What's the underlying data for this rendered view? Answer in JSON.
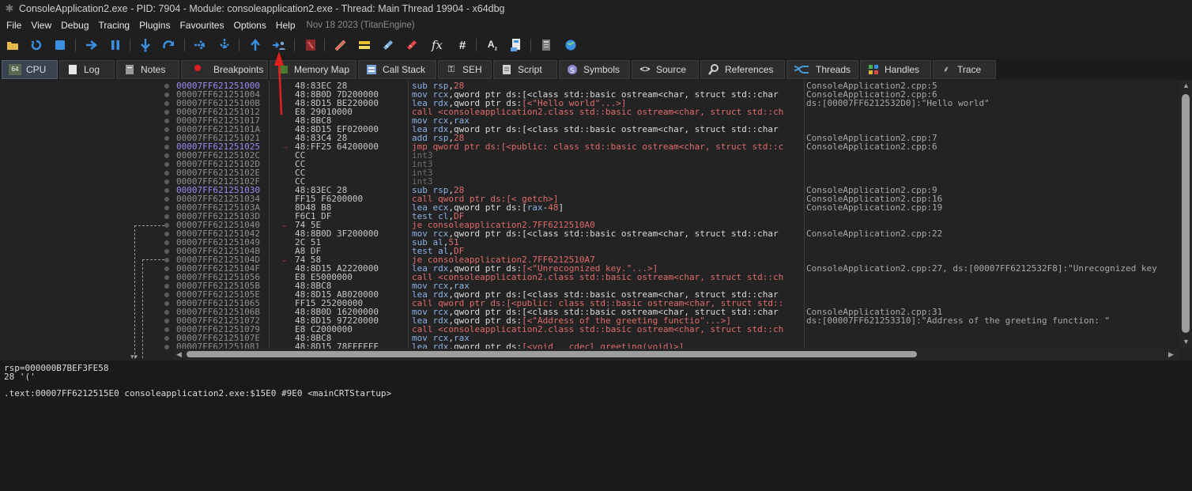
{
  "window": {
    "title": "ConsoleApplication2.exe - PID: 7904 - Module: consoleapplication2.exe - Thread: Main Thread 19904 - x64dbg"
  },
  "menu": [
    "File",
    "View",
    "Debug",
    "Tracing",
    "Plugins",
    "Favourites",
    "Options",
    "Help"
  ],
  "build": "Nov 18 2023 (TitanEngine)",
  "toolbar_icons": [
    "open-icon",
    "restart-icon",
    "stop-icon",
    "run-icon",
    "pause-icon",
    "step-into-icon",
    "step-over-icon",
    "trace-into-icon",
    "trace-over-icon",
    "execute-till-return-icon",
    "run-to-user-code-icon",
    "scylla-icon",
    "patch-icon",
    "comment-icon",
    "label-icon",
    "bookmark-icon",
    "function-icon",
    "hash-icon",
    "font-icon",
    "calc-icon",
    "notes-icon",
    "globe-icon"
  ],
  "tabs": [
    {
      "label": "CPU",
      "icon": "cpu-icon",
      "active": true
    },
    {
      "label": "Log",
      "icon": "log-icon"
    },
    {
      "label": "Notes",
      "icon": "notes-icon"
    },
    {
      "label": "Breakpoints",
      "icon": "breakpoint-icon"
    },
    {
      "label": "Memory Map",
      "icon": "memory-icon"
    },
    {
      "label": "Call Stack",
      "icon": "callstack-icon"
    },
    {
      "label": "SEH",
      "icon": "seh-icon"
    },
    {
      "label": "Script",
      "icon": "script-icon"
    },
    {
      "label": "Symbols",
      "icon": "symbols-icon"
    },
    {
      "label": "Source",
      "icon": "source-icon"
    },
    {
      "label": "References",
      "icon": "references-icon"
    },
    {
      "label": "Threads",
      "icon": "threads-icon"
    },
    {
      "label": "Handles",
      "icon": "handles-icon"
    },
    {
      "label": "Trace",
      "icon": "trace-icon"
    }
  ],
  "disasm": [
    {
      "addr": "00007FF621251000",
      "bytes": "48:83EC 28",
      "ins": "sub rsp,28",
      "comment": "ConsoleApplication2.cpp:5",
      "hl": true
    },
    {
      "addr": "00007FF621251004",
      "bytes": "48:8B0D 7D200000",
      "ins": "mov rcx,qword ptr ds:[<class std::basic_ostream<char, struct std::char_",
      "comment": "ConsoleApplication2.cpp:6"
    },
    {
      "addr": "00007FF62125100B",
      "bytes": "48:8D15 BE220000",
      "ins": "lea rdx,qword ptr ds:[<\"Hello world\"...>]",
      "comment": "ds:[00007FF6212532D0]:\"Hello world\""
    },
    {
      "addr": "00007FF621251012",
      "bytes": "E8 29010000",
      "ins": "call <consoleapplication2.class std::basic_ostream<char, struct std::ch",
      "comment": ""
    },
    {
      "addr": "00007FF621251017",
      "bytes": "48:8BC8",
      "ins": "mov rcx,rax",
      "comment": ""
    },
    {
      "addr": "00007FF62125101A",
      "bytes": "48:8D15 EF020000",
      "ins": "lea rdx,qword ptr ds:[<class std::basic_ostream<char, struct std::char_",
      "comment": ""
    },
    {
      "addr": "00007FF621251021",
      "bytes": "48:83C4 28",
      "ins": "add rsp,28",
      "comment": "ConsoleApplication2.cpp:7"
    },
    {
      "addr": "00007FF621251025",
      "bytes": "48:FF25 64200000",
      "ins": "jmp qword ptr ds:[<public: class std::basic_ostream<char, struct std::c",
      "comment": "ConsoleApplication2.cpp:6",
      "hl": true
    },
    {
      "addr": "00007FF62125102C",
      "bytes": "CC",
      "ins": "int3",
      "comment": ""
    },
    {
      "addr": "00007FF62125102D",
      "bytes": "CC",
      "ins": "int3",
      "comment": ""
    },
    {
      "addr": "00007FF62125102E",
      "bytes": "CC",
      "ins": "int3",
      "comment": ""
    },
    {
      "addr": "00007FF62125102F",
      "bytes": "CC",
      "ins": "int3",
      "comment": ""
    },
    {
      "addr": "00007FF621251030",
      "bytes": "48:83EC 28",
      "ins": "sub rsp,28",
      "comment": "ConsoleApplication2.cpp:9",
      "hl": true
    },
    {
      "addr": "00007FF621251034",
      "bytes": "FF15 F6200000",
      "ins": "call qword ptr ds:[<_getch>]",
      "comment": "ConsoleApplication2.cpp:16"
    },
    {
      "addr": "00007FF62125103A",
      "bytes": "8D48 B8",
      "ins": "lea ecx,qword ptr ds:[rax-48]",
      "comment": "ConsoleApplication2.cpp:19"
    },
    {
      "addr": "00007FF62125103D",
      "bytes": "F6C1 DF",
      "ins": "test cl,DF",
      "comment": ""
    },
    {
      "addr": "00007FF621251040",
      "bytes": "74 5E",
      "ins": "je consoleapplication2.7FF6212510A0",
      "comment": ""
    },
    {
      "addr": "00007FF621251042",
      "bytes": "48:8B0D 3F200000",
      "ins": "mov rcx,qword ptr ds:[<class std::basic_ostream<char, struct std::char_",
      "comment": "ConsoleApplication2.cpp:22"
    },
    {
      "addr": "00007FF621251049",
      "bytes": "2C 51",
      "ins": "sub al,51",
      "comment": ""
    },
    {
      "addr": "00007FF62125104B",
      "bytes": "A8 DF",
      "ins": "test al,DF",
      "comment": ""
    },
    {
      "addr": "00007FF62125104D",
      "bytes": "74 58",
      "ins": "je consoleapplication2.7FF6212510A7",
      "comment": ""
    },
    {
      "addr": "00007FF62125104F",
      "bytes": "48:8D15 A2220000",
      "ins": "lea rdx,qword ptr ds:[<\"Unrecognized key.\"...>]",
      "comment": "ConsoleApplication2.cpp:27, ds:[00007FF6212532F8]:\"Unrecognized key"
    },
    {
      "addr": "00007FF621251056",
      "bytes": "E8 E5000000",
      "ins": "call <consoleapplication2.class std::basic_ostream<char, struct std::ch",
      "comment": ""
    },
    {
      "addr": "00007FF62125105B",
      "bytes": "48:8BC8",
      "ins": "mov rcx,rax",
      "comment": ""
    },
    {
      "addr": "00007FF62125105E",
      "bytes": "48:8D15 AB020000",
      "ins": "lea rdx,qword ptr ds:[<class std::basic_ostream<char, struct std::char_",
      "comment": ""
    },
    {
      "addr": "00007FF621251065",
      "bytes": "FF15 25200000",
      "ins": "call qword ptr ds:[<public: class std::basic_ostream<char, struct std::",
      "comment": ""
    },
    {
      "addr": "00007FF62125106B",
      "bytes": "48:8B0D 16200000",
      "ins": "mov rcx,qword ptr ds:[<class std::basic_ostream<char, struct std::char_",
      "comment": "ConsoleApplication2.cpp:31"
    },
    {
      "addr": "00007FF621251072",
      "bytes": "48:8D15 97220000",
      "ins": "lea rdx,qword ptr ds:[<\"Address of the greeting functio\"...>]",
      "comment": "ds:[00007FF621253310]:\"Address of the greeting function: \""
    },
    {
      "addr": "00007FF621251079",
      "bytes": "E8 C2000000",
      "ins": "call <consoleapplication2.class std::basic_ostream<char, struct std::ch",
      "comment": ""
    },
    {
      "addr": "00007FF62125107E",
      "bytes": "48:8BC8",
      "ins": "mov rcx,rax",
      "comment": ""
    },
    {
      "addr": "00007FF621251081",
      "bytes": "48:8D15 78FFFFFF",
      "ins": "lea rdx,qword ptr ds:[<void __cdecl greeting(void)>]",
      "comment": ""
    }
  ],
  "info": {
    "line1": "rsp=000000B7BEF3FE58",
    "line2": "28 '('",
    "line3": ".text:00007FF6212515E0 consoleapplication2.exe:$15E0 #9E0 <mainCRTStartup>"
  },
  "annotation_color": "#e0201e"
}
